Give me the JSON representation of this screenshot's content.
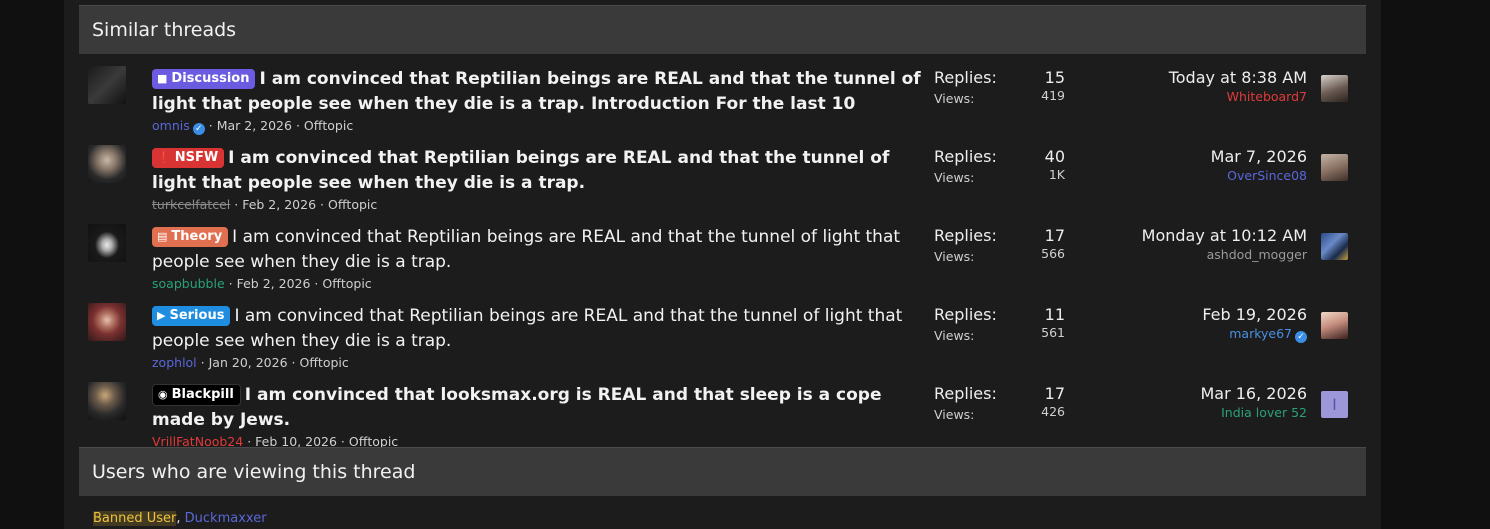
{
  "similar": {
    "header": "Similar threads",
    "threads": [
      {
        "label": "Discussion",
        "label_icon": "chat-icon",
        "bold": true,
        "title": "I am convinced that Reptilian beings are REAL and that the tunnel of light that people see when they die is a trap. Introduction For the last 10",
        "author": "omnis",
        "author_verified": true,
        "date": "Mar 2, 2026",
        "forum": "Offtopic",
        "replies_label": "Replies:",
        "replies": "15",
        "views_label": "Views:",
        "views": "419",
        "last_date": "Today at 8:38 AM",
        "last_user": "Whiteboard7"
      },
      {
        "label": "NSFW",
        "label_icon": "alert-icon",
        "bold": true,
        "title": "I am convinced that Reptilian beings are REAL and that the tunnel of light that people see when they die is a trap.",
        "author": "turkcelfatcel",
        "author_verified": false,
        "date": "Feb 2, 2026",
        "forum": "Offtopic",
        "replies_label": "Replies:",
        "replies": "40",
        "views_label": "Views:",
        "views": "1K",
        "last_date": "Mar 7, 2026",
        "last_user": "OverSince08"
      },
      {
        "label": "Theory",
        "label_icon": "scroll-icon",
        "bold": false,
        "title": "I am convinced that Reptilian beings are REAL and that the tunnel of light that people see when they die is a trap.",
        "author": "soapbubble",
        "author_verified": false,
        "date": "Feb 2, 2026",
        "forum": "Offtopic",
        "replies_label": "Replies:",
        "replies": "17",
        "views_label": "Views:",
        "views": "566",
        "last_date": "Monday at 10:12 AM",
        "last_user": "ashdod_mogger"
      },
      {
        "label": "Serious",
        "label_icon": "megaphone-icon",
        "bold": false,
        "title": "I am convinced that Reptilian beings are REAL and that the tunnel of light that people see when they die is a trap.",
        "author": "zophlol",
        "author_verified": false,
        "date": "Jan 20, 2026",
        "forum": "Offtopic",
        "replies_label": "Replies:",
        "replies": "11",
        "views_label": "Views:",
        "views": "561",
        "last_date": "Feb 19, 2026",
        "last_user": "markye67",
        "last_user_verified": true
      },
      {
        "label": "Blackpill",
        "label_icon": "glasses-icon",
        "bold": true,
        "title": "I am convinced that looksmax.org is REAL and that sleep is a cope made by Jews.",
        "author": "VrillFatNoob24",
        "author_verified": false,
        "date": "Feb 10, 2026",
        "forum": "Offtopic",
        "replies_label": "Replies:",
        "replies": "17",
        "views_label": "Views:",
        "views": "426",
        "last_date": "Mar 16, 2026",
        "last_user": "India lover 52",
        "last_avatar_letter": "I"
      }
    ]
  },
  "viewing": {
    "header": "Users who are viewing this thread",
    "users": [
      "Banned User",
      "Duckmaxxer"
    ],
    "separator": ", "
  },
  "colors": {
    "page_bg": "#101010",
    "block_bg": "#1c1c1c",
    "header_bg": "#3a3a3a",
    "discussion": "#6b5be0",
    "nsfw": "#d93434",
    "theory": "#e07050",
    "serious": "#1f8ee0",
    "blackpill": "#000000"
  }
}
